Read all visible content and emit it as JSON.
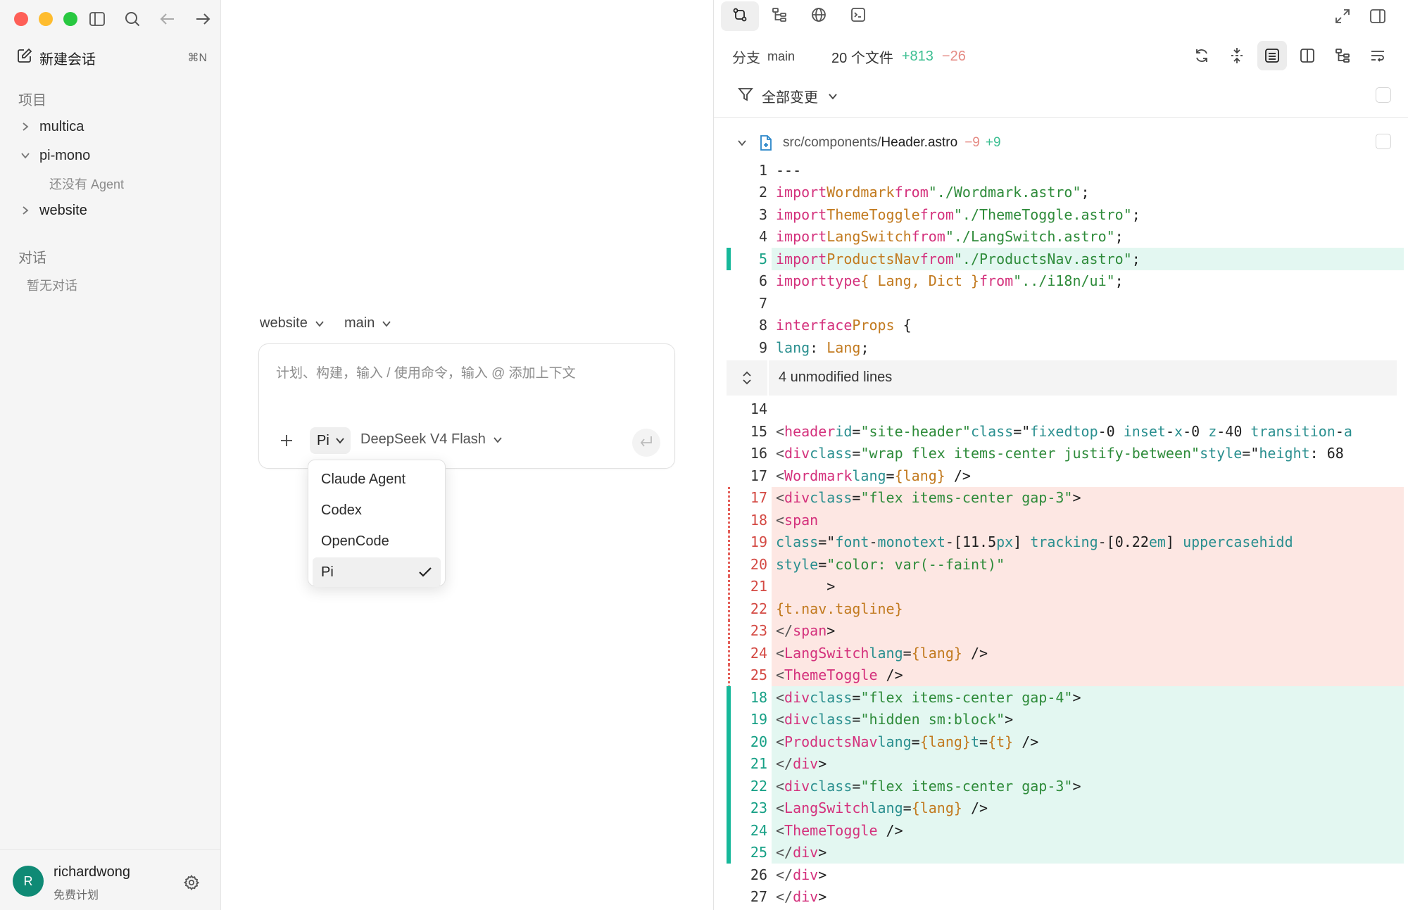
{
  "sidebar": {
    "new_chat": "新建会话",
    "new_chat_shortcut": "⌘N",
    "projects_label": "项目",
    "projects": [
      {
        "name": "multica",
        "expanded": false
      },
      {
        "name": "pi-mono",
        "expanded": true,
        "note": "还没有 Agent"
      },
      {
        "name": "website",
        "expanded": false
      }
    ],
    "conversations_label": "对话",
    "conversations_empty": "暂无对话",
    "user": {
      "initial": "R",
      "name": "richardwong",
      "plan": "免费计划"
    }
  },
  "composer": {
    "project": "website",
    "branch": "main",
    "placeholder": "计划、构建，输入 / 使用命令，输入 @ 添加上下文",
    "agent": "Pi",
    "model": "DeepSeek V4 Flash",
    "agent_options": [
      "Claude Agent",
      "Codex",
      "OpenCode",
      "Pi"
    ],
    "selected_agent": "Pi"
  },
  "diff": {
    "branch_label": "分支",
    "branch": "main",
    "files_count": "20 个文件",
    "additions": "+813",
    "deletions": "−26",
    "filter": "全部变更",
    "file": {
      "dir": "src/components/",
      "name": "Header.astro",
      "deletions": "−9",
      "additions": "+9"
    },
    "collapsed_label": "4 unmodified lines",
    "lines": [
      {
        "n": "1",
        "type": "ctx",
        "code": "---"
      },
      {
        "n": "2",
        "type": "ctx",
        "code": "import Wordmark from \"./Wordmark.astro\";"
      },
      {
        "n": "3",
        "type": "ctx",
        "code": "import ThemeToggle from \"./ThemeToggle.astro\";"
      },
      {
        "n": "4",
        "type": "ctx",
        "code": "import LangSwitch from \"./LangSwitch.astro\";"
      },
      {
        "n": "5",
        "type": "add",
        "code": "import ProductsNav from \"./ProductsNav.astro\";"
      },
      {
        "n": "6",
        "type": "ctx",
        "code": "import type { Lang, Dict } from \"../i18n/ui\";"
      },
      {
        "n": "7",
        "type": "ctx",
        "code": ""
      },
      {
        "n": "8",
        "type": "ctx",
        "code": "interface Props {"
      },
      {
        "n": "9",
        "type": "ctx",
        "code": "  lang: Lang;"
      },
      {
        "n": "14",
        "type": "ctx",
        "code": ""
      },
      {
        "n": "15",
        "type": "ctx",
        "code": "<header id=\"site-header\" class=\"fixed top-0 inset-x-0 z-40 transition-a"
      },
      {
        "n": "16",
        "type": "ctx",
        "code": "  <div class=\"wrap flex items-center justify-between\" style=\"height: 68"
      },
      {
        "n": "17",
        "type": "ctx",
        "code": "    <Wordmark lang={lang} />"
      },
      {
        "n": "17",
        "type": "del",
        "code": "    <div class=\"flex items-center gap-3\">"
      },
      {
        "n": "18",
        "type": "del",
        "code": "      <span"
      },
      {
        "n": "19",
        "type": "del",
        "code": "        class=\"font-mono text-[11.5px] tracking-[0.22em] uppercase hidd"
      },
      {
        "n": "20",
        "type": "del",
        "code": "        style=\"color: var(--faint)\""
      },
      {
        "n": "21",
        "type": "del",
        "code": "      >"
      },
      {
        "n": "22",
        "type": "del",
        "code": "        {t.nav.tagline}"
      },
      {
        "n": "23",
        "type": "del",
        "code": "      </span>"
      },
      {
        "n": "24",
        "type": "del",
        "code": "      <LangSwitch lang={lang} />"
      },
      {
        "n": "25",
        "type": "del",
        "code": "      <ThemeToggle />"
      },
      {
        "n": "18",
        "type": "add",
        "code": "    <div class=\"flex items-center gap-4\">"
      },
      {
        "n": "19",
        "type": "add",
        "code": "      <div class=\"hidden sm:block\">"
      },
      {
        "n": "20",
        "type": "add",
        "code": "        <ProductsNav lang={lang} t={t} />"
      },
      {
        "n": "21",
        "type": "add",
        "code": "      </div>"
      },
      {
        "n": "22",
        "type": "add",
        "code": "      <div class=\"flex items-center gap-3\">"
      },
      {
        "n": "23",
        "type": "add",
        "code": "        <LangSwitch lang={lang} />"
      },
      {
        "n": "24",
        "type": "add",
        "code": "        <ThemeToggle />"
      },
      {
        "n": "25",
        "type": "add",
        "code": "      </div>"
      },
      {
        "n": "26",
        "type": "ctx",
        "code": "    </div>"
      },
      {
        "n": "27",
        "type": "ctx",
        "code": "  </div>"
      }
    ]
  },
  "colors": {
    "accent_green": "#16b89a",
    "delete_red": "#e4605a",
    "avatar": "#0f8a75"
  },
  "icons": [
    "sidebar-toggle-icon",
    "search-icon",
    "back-arrow-icon",
    "forward-arrow-icon",
    "compose-icon",
    "chevron-right-icon",
    "chevron-down-icon",
    "gear-icon",
    "plus-icon",
    "enter-icon",
    "check-icon",
    "git-diff-icon",
    "tree-icon",
    "globe-icon",
    "terminal-icon",
    "expand-icon",
    "panel-icon",
    "refresh-icon",
    "collapse-icon",
    "unified-view-icon",
    "split-view-icon",
    "tree-view-icon",
    "wrap-icon",
    "filter-icon",
    "file-icon",
    "expand-lines-icon"
  ]
}
